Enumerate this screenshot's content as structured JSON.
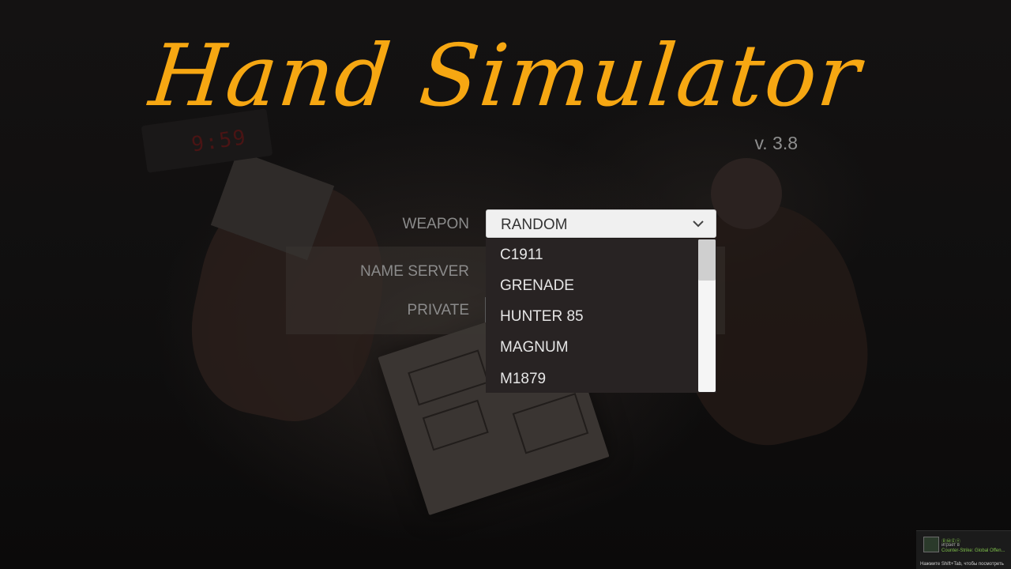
{
  "title": "Hand Simulator",
  "version": "v. 3.8",
  "background": {
    "clock_display": "9:59"
  },
  "form": {
    "weapon_label": "WEAPON",
    "name_server_label": "NAME SERVER",
    "private_label": "PRIVATE",
    "weapon_select": {
      "selected": "RANDOM",
      "options": [
        "C1911",
        "GRENADE",
        "HUNTER 85",
        "MAGNUM",
        "M1879"
      ]
    }
  },
  "overlay": {
    "friend_name": "ⓇⓌⒺⓉ",
    "status": "играет в",
    "game": "Counter-Strike: Global Offen...",
    "hint": "Нажмите Shift+Tab, чтобы посмотреть"
  },
  "colors": {
    "title": "#f6a712",
    "label": "#8b8b8b",
    "dropdown_bg": "#282323",
    "select_bg": "#f0f0f0"
  }
}
